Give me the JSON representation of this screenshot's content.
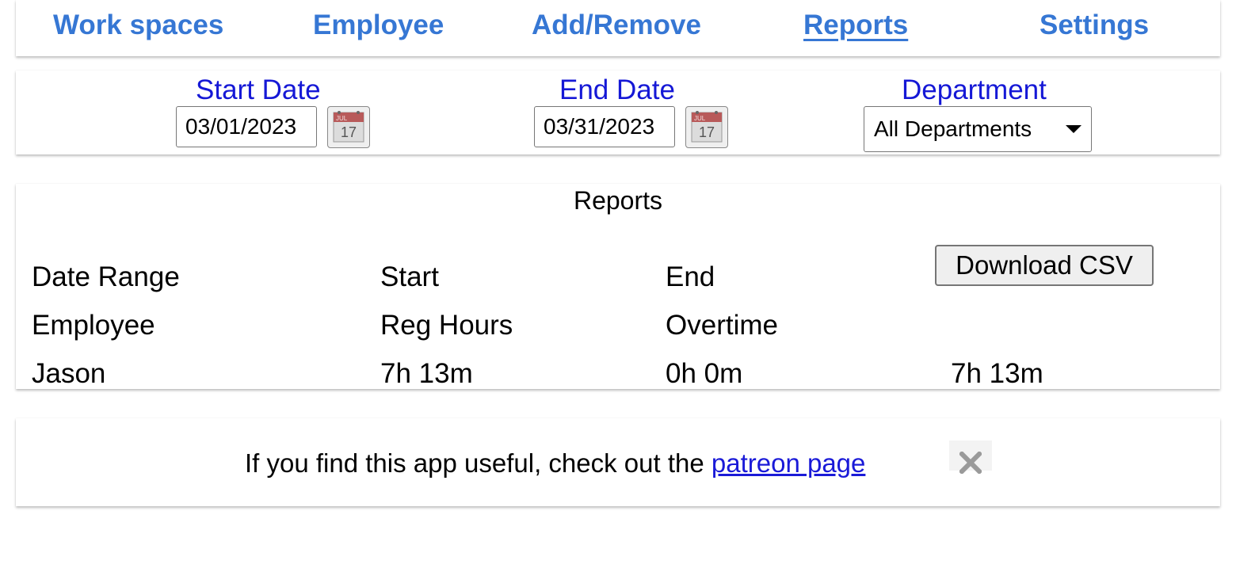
{
  "nav": {
    "items": [
      {
        "label": "Work spaces"
      },
      {
        "label": "Employee"
      },
      {
        "label": "Add/Remove"
      },
      {
        "label": "Reports",
        "active": true
      },
      {
        "label": "Settings"
      }
    ]
  },
  "filters": {
    "start_date": {
      "label": "Start Date",
      "value": "03/01/2023"
    },
    "end_date": {
      "label": "End Date",
      "value": "03/31/2023"
    },
    "department": {
      "label": "Department",
      "selected": "All Departments"
    },
    "calendar_icon": {
      "month": "JUL",
      "day": "17"
    }
  },
  "reports": {
    "title": "Reports",
    "download_label": "Download CSV",
    "range_row": [
      "Date Range",
      "Start",
      "End"
    ],
    "headers": [
      "Employee",
      "Reg Hours",
      "Overtime"
    ],
    "rows": [
      {
        "employee": "Jason",
        "reg_hours": "7h 13m",
        "overtime": "0h 0m",
        "total": "7h 13m"
      }
    ]
  },
  "banner": {
    "text": "If you find this app useful, check out the ",
    "link_text": "patreon page"
  },
  "colors": {
    "nav_link": "#3677d4",
    "filter_label": "#1518d6",
    "link": "#1a1ad8"
  }
}
